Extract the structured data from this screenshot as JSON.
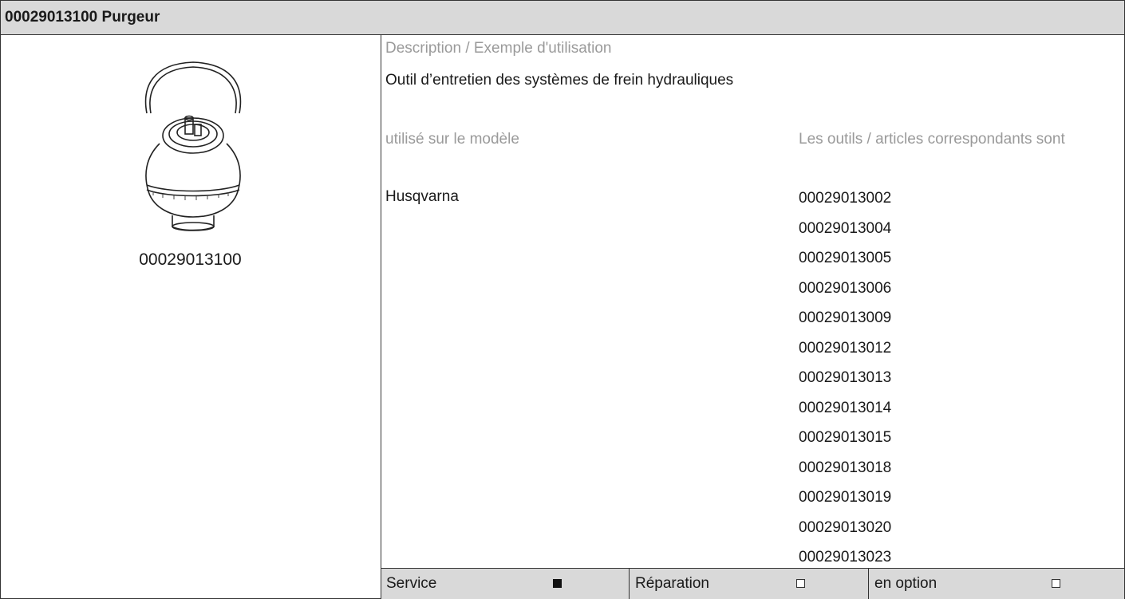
{
  "title": "00029013100 Purgeur",
  "tool_number": "00029013100",
  "description": {
    "label": "Description / Exemple d'utilisation",
    "text": "Outil d’entretien des systèmes de frein hydrauliques"
  },
  "model": {
    "label": "utilisé sur le modèle",
    "value": "Husqvarna"
  },
  "related": {
    "label": "Les outils / articles correspondants sont",
    "items": [
      "00029013002",
      "00029013004",
      "00029013005",
      "00029013006",
      "00029013009",
      "00029013012",
      "00029013013",
      "00029013014",
      "00029013015",
      "00029013018",
      "00029013019",
      "00029013020",
      "00029013023"
    ]
  },
  "footer": {
    "service": {
      "label": "Service",
      "checked": true
    },
    "repair": {
      "label": "Réparation",
      "checked": false
    },
    "optional": {
      "label": "en option",
      "checked": false
    }
  },
  "image": {
    "name": "brake-bleeder-tool"
  }
}
